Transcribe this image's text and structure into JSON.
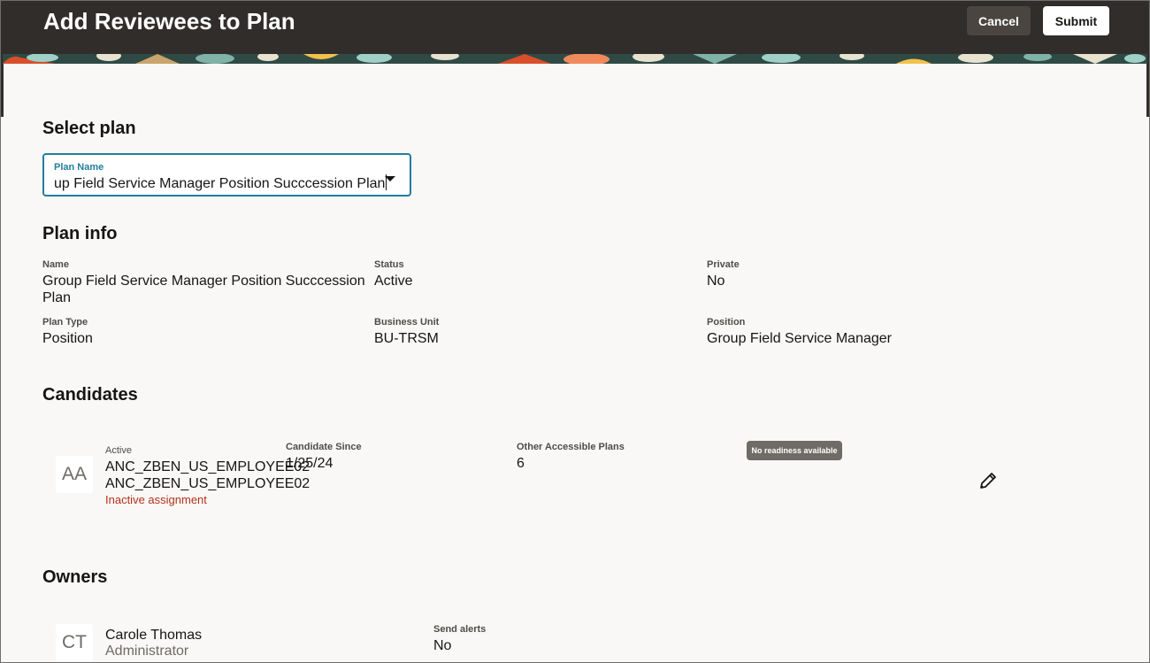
{
  "header": {
    "title": "Add Reviewees to Plan",
    "cancel_label": "Cancel",
    "submit_label": "Submit"
  },
  "select_plan": {
    "heading": "Select plan",
    "field_label": "Plan Name",
    "field_value": "up Field Service Manager Position Succcession Plan"
  },
  "plan_info": {
    "heading": "Plan info",
    "name_label": "Name",
    "name_value_line1": "Group Field Service Manager Position Succcession",
    "name_value_line2": "Plan",
    "status_label": "Status",
    "status_value": "Active",
    "private_label": "Private",
    "private_value": "No",
    "plan_type_label": "Plan Type",
    "plan_type_value": "Position",
    "business_unit_label": "Business Unit",
    "business_unit_value": "BU-TRSM",
    "position_label": "Position",
    "position_value": "Group Field Service Manager"
  },
  "candidates": {
    "heading": "Candidates",
    "items": [
      {
        "initials": "AA",
        "status": "Active",
        "name_line1": "ANC_ZBEN_US_EMPLOYEE02",
        "name_line2": "ANC_ZBEN_US_EMPLOYEE02",
        "assignment_note": "Inactive assignment",
        "since_label": "Candidate Since",
        "since_value": "1/25/24",
        "other_plans_label": "Other Accessible Plans",
        "other_plans_value": "6",
        "readiness_badge": "No readiness available"
      }
    ]
  },
  "owners": {
    "heading": "Owners",
    "items": [
      {
        "initials": "CT",
        "name": "Carole Thomas",
        "role": "Administrator",
        "alerts_label": "Send alerts",
        "alerts_value": "No"
      }
    ]
  },
  "icons": {
    "dropdown": "chevron-down-icon",
    "edit": "pencil-icon"
  },
  "colors": {
    "header_bg": "#312d2a",
    "accent": "#227e9e",
    "error": "#b3311b",
    "page_bg": "#f9f8f6"
  }
}
